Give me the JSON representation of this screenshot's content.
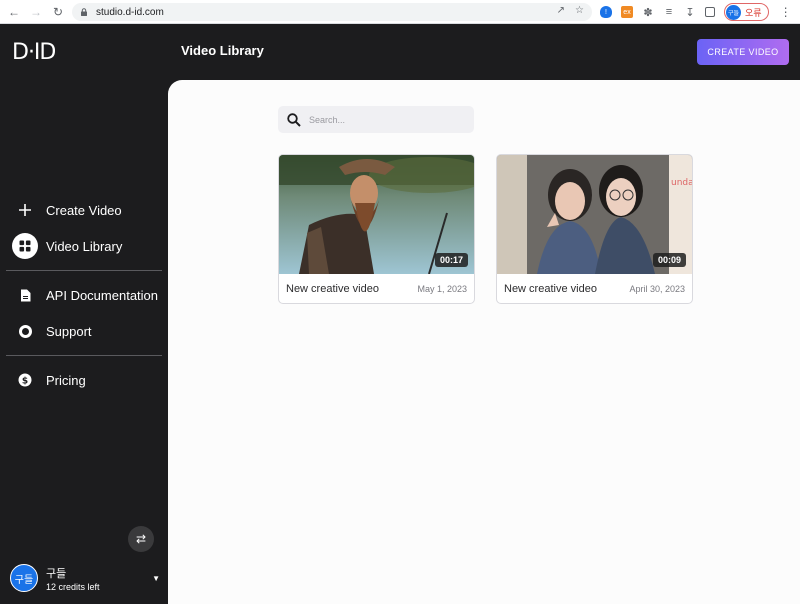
{
  "browser": {
    "url": "studio.d-id.com",
    "profile_avatar": "구들",
    "profile_status": "오류"
  },
  "sidebar": {
    "logo": "D·ID",
    "items": [
      {
        "label": "Create Video",
        "icon": "plus-icon"
      },
      {
        "label": "Video Library",
        "icon": "grid-icon",
        "active": true
      },
      {
        "label": "API Documentation",
        "icon": "document-icon"
      },
      {
        "label": "Support",
        "icon": "lifebuoy-icon"
      },
      {
        "label": "Pricing",
        "icon": "dollar-icon"
      }
    ],
    "user": {
      "avatar_text": "구들",
      "name": "구들",
      "credits": "12 credits left"
    }
  },
  "header": {
    "title": "Video Library",
    "create_button": "CREATE VIDEO"
  },
  "search": {
    "placeholder": "Search..."
  },
  "videos": [
    {
      "title": "New creative video",
      "date": "May 1, 2023",
      "duration": "00:17"
    },
    {
      "title": "New creative video",
      "date": "April 30, 2023",
      "duration": "00:09"
    }
  ],
  "colors": {
    "sidebar_bg": "#1c1c1e",
    "accent_gradient_start": "#6b63f5",
    "accent_gradient_end": "#b06cf0",
    "main_bg": "#fcfcfc"
  }
}
